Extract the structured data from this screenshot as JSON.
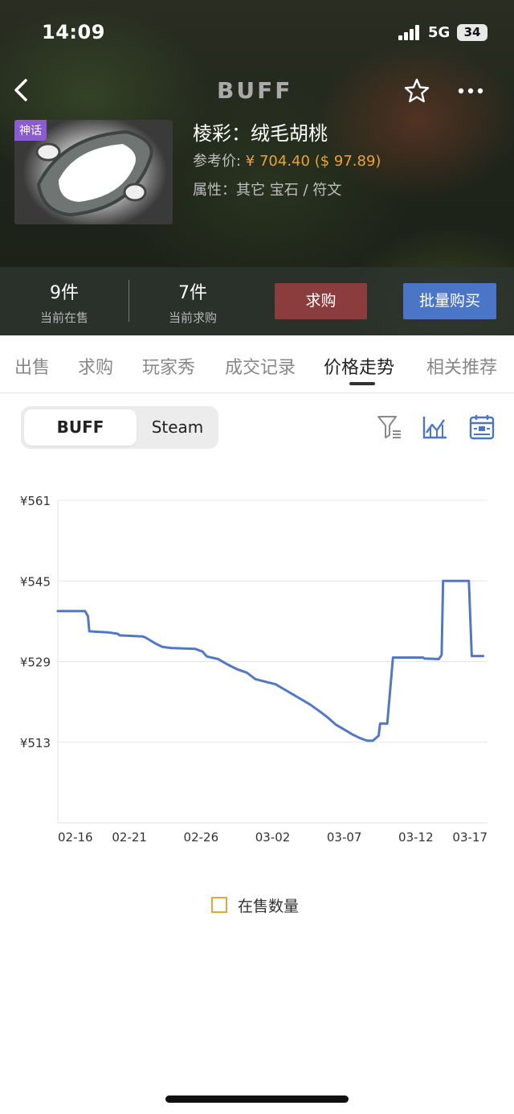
{
  "status_bar": {
    "time": "14:09",
    "network": "5G",
    "battery": "34"
  },
  "nav": {
    "brand": "BUFF"
  },
  "item": {
    "rarity": "神话",
    "title": "棱彩：绒毛胡桃",
    "price_label": "参考价: ",
    "price_cny": "¥ 704.40",
    "price_usd": "($ 97.89)",
    "attributes": "属性：其它 宝石 / 符文"
  },
  "stats": {
    "on_sale_count": "9件",
    "on_sale_label": "当前在售",
    "buy_order_count": "7件",
    "buy_order_label": "当前求购",
    "want_buy_button": "求购",
    "bulk_buy_button": "批量购买"
  },
  "tabs": [
    {
      "label": "出售"
    },
    {
      "label": "求购"
    },
    {
      "label": "玩家秀"
    },
    {
      "label": "成交记录"
    },
    {
      "label": "价格走势",
      "active": true
    },
    {
      "label": "相关推荐"
    }
  ],
  "toggle": {
    "buff": "BUFF",
    "steam": "Steam",
    "selected": "BUFF"
  },
  "tools": [
    "filter-icon",
    "line-chart-icon",
    "calendar-icon"
  ],
  "colors": {
    "line": "#5278c4",
    "want_buy": "#8b3d3d",
    "bulk_buy": "#4b76c7",
    "price": "#e8a23a",
    "rarity": "#8a5cd1"
  },
  "chart_data": {
    "type": "line",
    "ylim": [
      497,
      561
    ],
    "ytick_labels": [
      "¥561",
      "¥545",
      "¥529",
      "¥513"
    ],
    "ytick_values": [
      561,
      545,
      529,
      513
    ],
    "xtick_labels": [
      "02-16",
      "02-21",
      "02-26",
      "03-02",
      "03-07",
      "03-12",
      "03-17"
    ],
    "xtick_values": [
      0,
      5,
      10,
      15,
      20,
      25,
      30
    ],
    "xlim": [
      0,
      30
    ],
    "grid": true,
    "legend": [
      {
        "label": "在售数量",
        "color": "#e3a63b",
        "position": "bottom-center"
      }
    ],
    "series": [
      {
        "values": [
          [
            0,
            539
          ],
          [
            1.9,
            539
          ],
          [
            2.1,
            538
          ],
          [
            2.2,
            535
          ],
          [
            3.5,
            534.8
          ],
          [
            4.2,
            534.5
          ],
          [
            4.3,
            534.2
          ],
          [
            5.9,
            534
          ],
          [
            6.1,
            533.8
          ],
          [
            6.8,
            532.6
          ],
          [
            7.3,
            531.9
          ],
          [
            7.9,
            531.7
          ],
          [
            9.6,
            531.5
          ],
          [
            10.1,
            531
          ],
          [
            10.4,
            530
          ],
          [
            11.2,
            529.5
          ],
          [
            11.8,
            528.5
          ],
          [
            12.5,
            527.5
          ],
          [
            13.2,
            526.8
          ],
          [
            13.8,
            525.5
          ],
          [
            14.5,
            525
          ],
          [
            15.2,
            524.5
          ],
          [
            15.8,
            523.5
          ],
          [
            16.4,
            522.5
          ],
          [
            17,
            521.5
          ],
          [
            17.6,
            520.5
          ],
          [
            18.2,
            519.3
          ],
          [
            18.8,
            518
          ],
          [
            19.4,
            516.5
          ],
          [
            20,
            515.5
          ],
          [
            20.6,
            514.5
          ],
          [
            21.1,
            513.8
          ],
          [
            21.6,
            513.3
          ],
          [
            22.0,
            513.3
          ],
          [
            22.4,
            514.3
          ],
          [
            22.5,
            516.7
          ],
          [
            23.0,
            516.7
          ],
          [
            23.4,
            529.8
          ],
          [
            25.5,
            529.8
          ],
          [
            25.6,
            529.6
          ],
          [
            26.6,
            529.5
          ],
          [
            26.8,
            530.3
          ],
          [
            26.9,
            545
          ],
          [
            28.7,
            545
          ],
          [
            28.9,
            530.1
          ],
          [
            29.7,
            530.1
          ]
        ]
      }
    ]
  }
}
